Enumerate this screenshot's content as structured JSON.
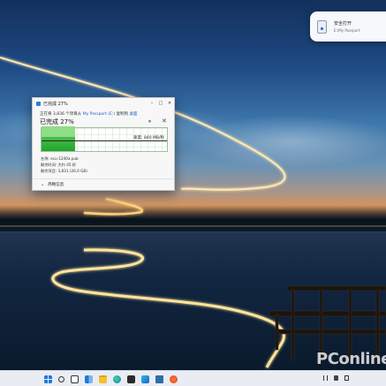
{
  "notification": {
    "title": "安全打开",
    "subtitle": "E:\\My Passport"
  },
  "dialog": {
    "window_title": "已完成 27%",
    "status_prefix": "正在将 3,836 个项目从",
    "source": "My Passport (E:)",
    "status_middle": "复制到",
    "destination": "桌面",
    "heading": "已完成 27%",
    "progress_percent": 27,
    "speed_text": "速度: 840 MB/秒",
    "name_line": "名称: ecu-1240a.pub",
    "time_remaining": "剩余时间: 大约 45 秒",
    "items_remaining": "剩余项目: 3,831 (26.0 GB)",
    "more_details": "简略信息"
  },
  "taskbar": {
    "icons": [
      "start-icon",
      "search-icon",
      "task-view-icon",
      "widgets-icon",
      "file-explorer-icon",
      "edge-icon",
      "store-icon",
      "app-icon",
      "vscode-icon",
      "browser-icon"
    ]
  },
  "watermark": "PConline",
  "colors": {
    "progress_green": "#1fa62c",
    "link_blue": "#1a62c8",
    "taskbar": "#e9edf3"
  }
}
